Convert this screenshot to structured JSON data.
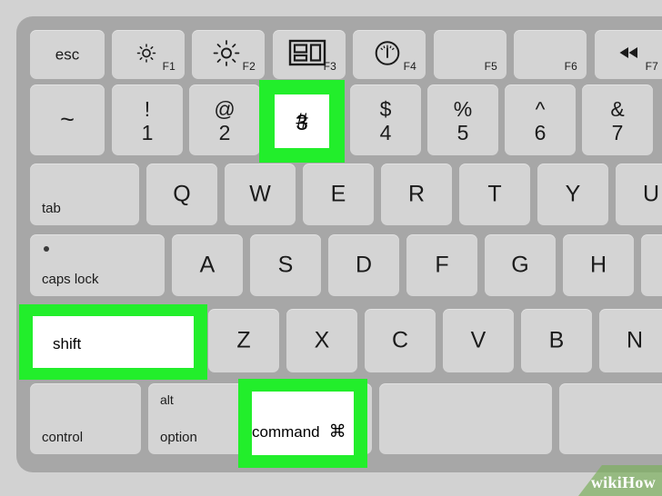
{
  "meta": {
    "subject": "apple-mac-keyboard",
    "highlight_color": "#22ee2b",
    "key_color": "#d4d4d4",
    "chassis_color": "#a7a7a7",
    "background_color": "#d2d2d2",
    "highlighted_keys": [
      "shift",
      "command",
      "3"
    ]
  },
  "watermark": {
    "wiki": "wiki",
    "how": "How"
  },
  "rows": {
    "function_row": [
      {
        "id": "esc",
        "label": "esc",
        "fn": "",
        "icon": ""
      },
      {
        "id": "f1",
        "label": "",
        "fn": "F1",
        "icon": "brightness-down-icon"
      },
      {
        "id": "f2",
        "label": "",
        "fn": "F2",
        "icon": "brightness-up-icon"
      },
      {
        "id": "f3",
        "label": "",
        "fn": "F3",
        "icon": "mission-control-icon"
      },
      {
        "id": "f4",
        "label": "",
        "fn": "F4",
        "icon": "dashboard-gauge-icon"
      },
      {
        "id": "f5",
        "label": "",
        "fn": "F5",
        "icon": ""
      },
      {
        "id": "f6",
        "label": "",
        "fn": "F6",
        "icon": ""
      },
      {
        "id": "f7",
        "label": "",
        "fn": "F7",
        "icon": "rewind-icon"
      }
    ],
    "number_row": [
      {
        "id": "tilde",
        "upper": "~",
        "lower": ""
      },
      {
        "id": "1",
        "upper": "!",
        "lower": "1"
      },
      {
        "id": "2",
        "upper": "@",
        "lower": "2"
      },
      {
        "id": "3",
        "upper": "#",
        "lower": "3",
        "highlighted": true
      },
      {
        "id": "4",
        "upper": "$",
        "lower": "4"
      },
      {
        "id": "5",
        "upper": "%",
        "lower": "5"
      },
      {
        "id": "6",
        "upper": "^",
        "lower": "6"
      },
      {
        "id": "7",
        "upper": "&",
        "lower": "7"
      }
    ],
    "qwerty_row": [
      {
        "id": "tab",
        "label": "tab",
        "wide": true
      },
      {
        "id": "q",
        "label": "Q"
      },
      {
        "id": "w",
        "label": "W"
      },
      {
        "id": "e",
        "label": "E"
      },
      {
        "id": "r",
        "label": "R"
      },
      {
        "id": "t",
        "label": "T"
      },
      {
        "id": "y",
        "label": "Y"
      },
      {
        "id": "u",
        "label": "U"
      }
    ],
    "home_row": [
      {
        "id": "capslock",
        "label": "caps lock",
        "wide": true,
        "led": true
      },
      {
        "id": "a",
        "label": "A"
      },
      {
        "id": "s",
        "label": "S"
      },
      {
        "id": "d",
        "label": "D"
      },
      {
        "id": "f",
        "label": "F"
      },
      {
        "id": "g",
        "label": "G"
      },
      {
        "id": "h",
        "label": "H"
      }
    ],
    "shift_row": [
      {
        "id": "shift",
        "label": "shift",
        "wide": true,
        "highlighted": true
      },
      {
        "id": "z",
        "label": "Z"
      },
      {
        "id": "x",
        "label": "X"
      },
      {
        "id": "c",
        "label": "C"
      },
      {
        "id": "v",
        "label": "V"
      },
      {
        "id": "b",
        "label": "B"
      },
      {
        "id": "n",
        "label": "N"
      }
    ],
    "bottom_row": [
      {
        "id": "control",
        "label": "control"
      },
      {
        "id": "option",
        "label": "option",
        "alt": "alt"
      },
      {
        "id": "command",
        "label": "command",
        "symbol": "⌘",
        "highlighted": true
      }
    ]
  }
}
